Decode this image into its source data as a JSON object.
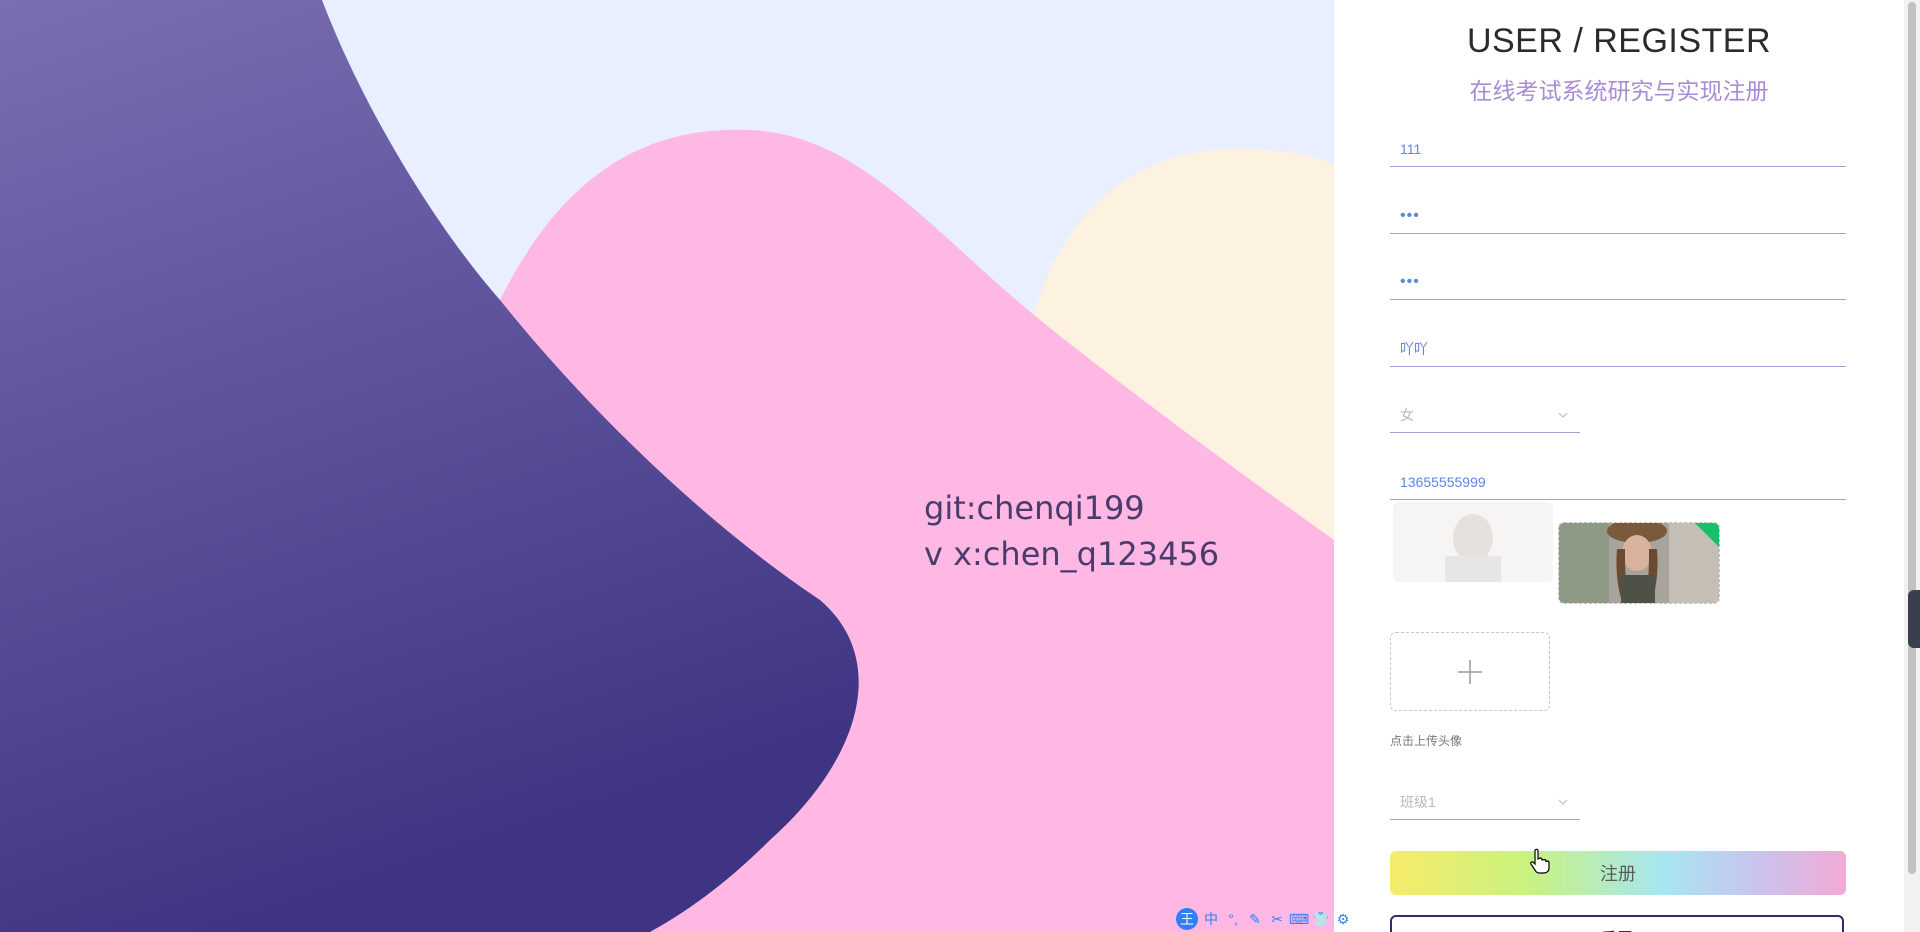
{
  "watermark": {
    "line1": "git:chenqi199",
    "line2": "v x:chen_q123456"
  },
  "form": {
    "title": "USER / REGISTER",
    "subtitle": "在线考试系统研究与实现注册",
    "username": "111",
    "password": "•••",
    "confirm_password": "•••",
    "nickname": "吖吖",
    "gender": "女",
    "phone": "13655555999",
    "upload_hint": "点击上传头像",
    "class": "班级1",
    "register_label": "注册",
    "reset_label": "重置"
  },
  "colors": {
    "accent": "#a98bd6",
    "input_text": "#5b86e5",
    "upload_success": "#19be6b",
    "reset_border": "#2c2e66"
  },
  "ime_toolbar": {
    "logo": "王",
    "items": [
      "中",
      "°,",
      "✎",
      "✂",
      "⌨",
      "👕",
      "⚙"
    ]
  }
}
